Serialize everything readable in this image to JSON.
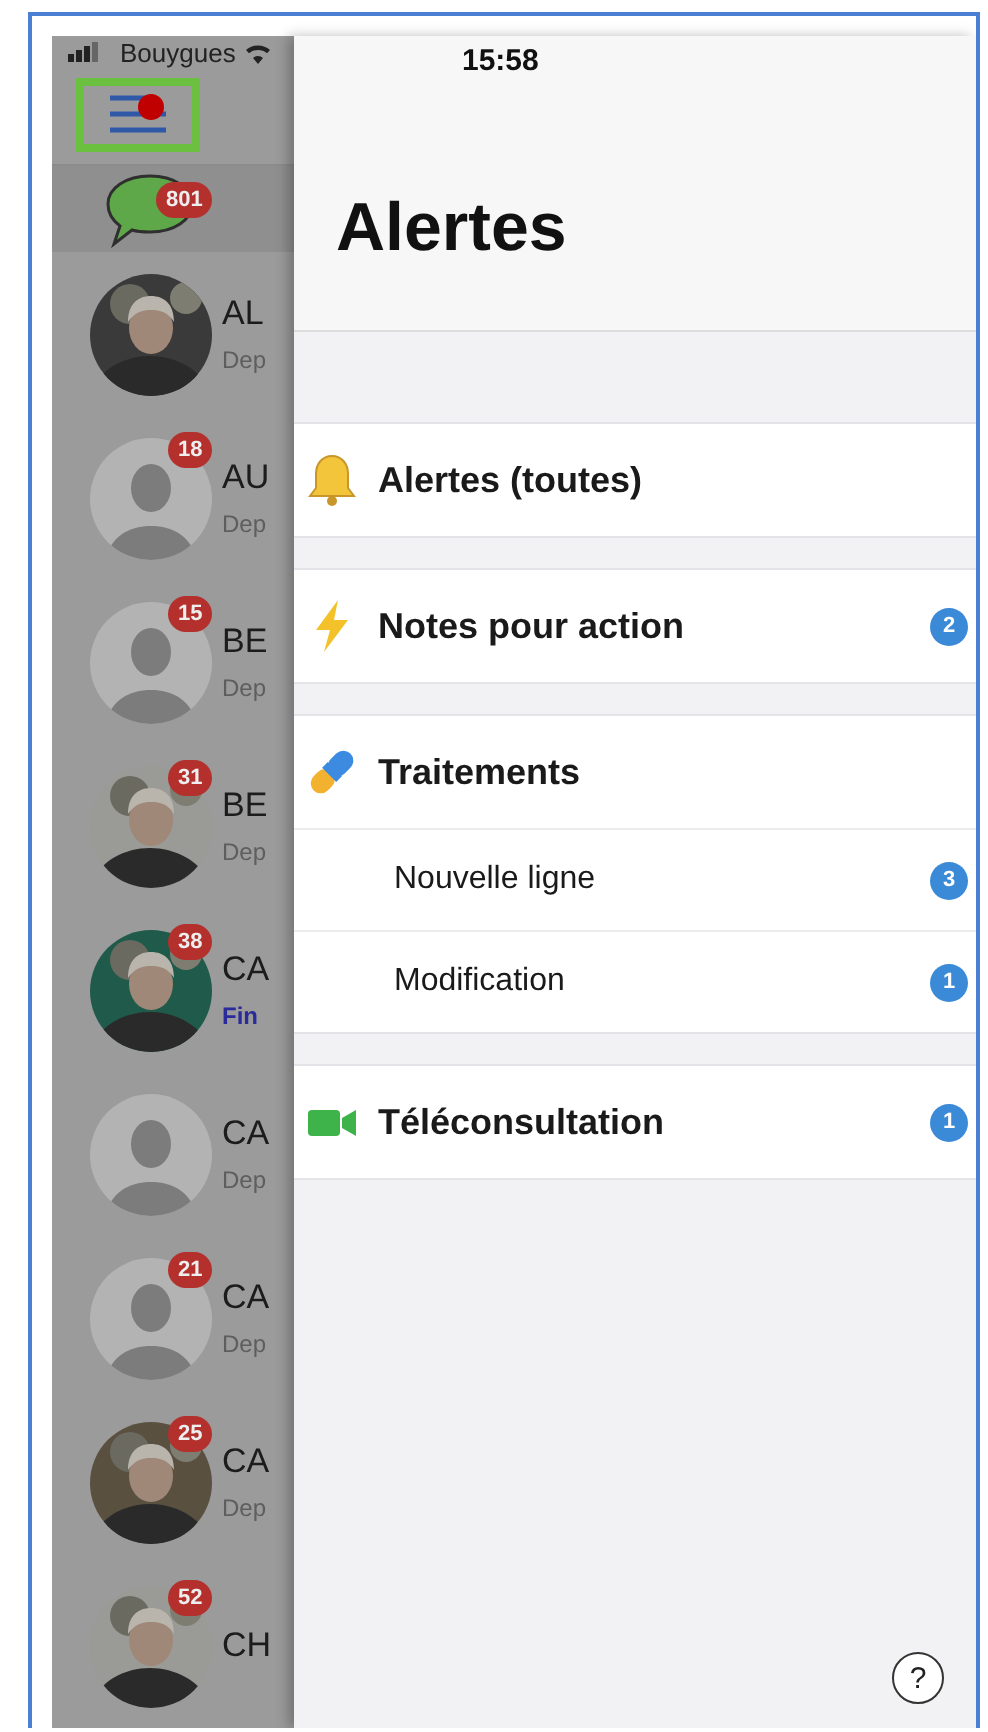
{
  "status_bar": {
    "carrier": "Bouygues",
    "time": "15:58"
  },
  "sidebar": {
    "menu_notification": true,
    "messages_badge": "801",
    "contacts": [
      {
        "name": "AL",
        "subtitle": "Dep",
        "highlighted": false
      },
      {
        "name": "AU",
        "subtitle": "Dep",
        "highlighted": false,
        "kind": "placeholder",
        "badge": "18"
      },
      {
        "name": "BE",
        "subtitle": "Dep",
        "highlighted": false,
        "kind": "placeholder",
        "badge": "15"
      },
      {
        "name": "BE",
        "subtitle": "Dep",
        "highlighted": false,
        "badge": "31"
      },
      {
        "name": "CA",
        "subtitle": "Fin",
        "highlighted": true,
        "badge": "38"
      },
      {
        "name": "CA",
        "subtitle": "Dep",
        "highlighted": false,
        "kind": "placeholder"
      },
      {
        "name": "CA",
        "subtitle": "Dep",
        "highlighted": false,
        "kind": "placeholder",
        "badge": "21"
      },
      {
        "name": "CA",
        "subtitle": "Dep",
        "highlighted": false,
        "badge": "25"
      },
      {
        "name": "CH",
        "badge": "52"
      }
    ]
  },
  "panel": {
    "title": "Alertes",
    "sections": [
      {
        "items": [
          {
            "kind": "bell",
            "label": "Alertes (toutes)"
          }
        ]
      },
      {
        "items": [
          {
            "kind": "bolt",
            "label": "Notes pour action",
            "badge": "2"
          }
        ]
      },
      {
        "items": [
          {
            "kind": "pill",
            "label": "Traitements"
          },
          {
            "kind": "sub",
            "label": "Nouvelle ligne",
            "badge": "3"
          },
          {
            "kind": "sub",
            "label": "Modification",
            "badge": "1"
          }
        ]
      },
      {
        "items": [
          {
            "kind": "video",
            "label": "Téléconsultation",
            "badge": "1"
          }
        ]
      }
    ],
    "help_button": "?"
  }
}
